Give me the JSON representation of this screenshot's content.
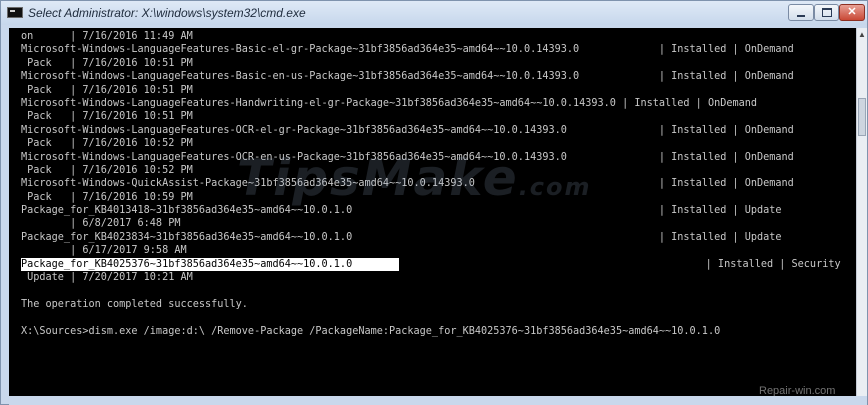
{
  "window": {
    "title": "Select Administrator: X:\\windows\\system32\\cmd.exe",
    "icon": "cmd-console-icon"
  },
  "colors": {
    "console_bg": "#000000",
    "console_text": "#c8c8c8",
    "highlight_bg": "#ffffff",
    "highlight_text": "#000000",
    "titlebar": "#c9d8ec",
    "close_button": "#c94835"
  },
  "console": {
    "lines": [
      "on      | 7/16/2016 11:49 AM",
      "Microsoft-Windows-LanguageFeatures-Basic-el-gr-Package~31bf3856ad364e35~amd64~~10.0.14393.0             | Installed | OnDemand",
      " Pack   | 7/16/2016 10:51 PM",
      "Microsoft-Windows-LanguageFeatures-Basic-en-us-Package~31bf3856ad364e35~amd64~~10.0.14393.0             | Installed | OnDemand",
      " Pack   | 7/16/2016 10:51 PM",
      "Microsoft-Windows-LanguageFeatures-Handwriting-el-gr-Package~31bf3856ad364e35~amd64~~10.0.14393.0 | Installed | OnDemand",
      " Pack   | 7/16/2016 10:51 PM",
      "Microsoft-Windows-LanguageFeatures-OCR-el-gr-Package~31bf3856ad364e35~amd64~~10.0.14393.0               | Installed | OnDemand",
      " Pack   | 7/16/2016 10:52 PM",
      "Microsoft-Windows-LanguageFeatures-OCR-en-us-Package~31bf3856ad364e35~amd64~~10.0.14393.0               | Installed | OnDemand",
      " Pack   | 7/16/2016 10:52 PM",
      "Microsoft-Windows-QuickAssist-Package~31bf3856ad364e35~amd64~~10.0.14393.0                              | Installed | OnDemand",
      " Pack   | 7/16/2016 10:59 PM",
      "Package_for_KB4013418~31bf3856ad364e35~amd64~~10.0.1.0                                                  | Installed | Update",
      "        | 6/8/2017 6:48 PM",
      "Package_for_KB4023834~31bf3856ad364e35~amd64~~10.0.1.0                                                  | Installed | Update",
      "        | 6/17/2017 9:58 AM",
      "Package_for_KB4025376~31bf3856ad364e35~amd64~~10.0.1.0                                                  | Installed | Security",
      " Update | 7/20/2017 10:21 AM",
      "",
      "The operation completed successfully.",
      "",
      "X:\\Sources>dism.exe /image:d:\\ /Remove-Package /PackageName:Package_for_KB4025376~31bf3856ad364e35~amd64~~10.0.1.0"
    ],
    "selection": "Package_for_KB4025376~31bf3856ad364e35~amd64~~10.0.1.0"
  },
  "watermark": {
    "main": "TipsMake",
    "suffix": ".com",
    "corner": "Repair-win.com"
  }
}
